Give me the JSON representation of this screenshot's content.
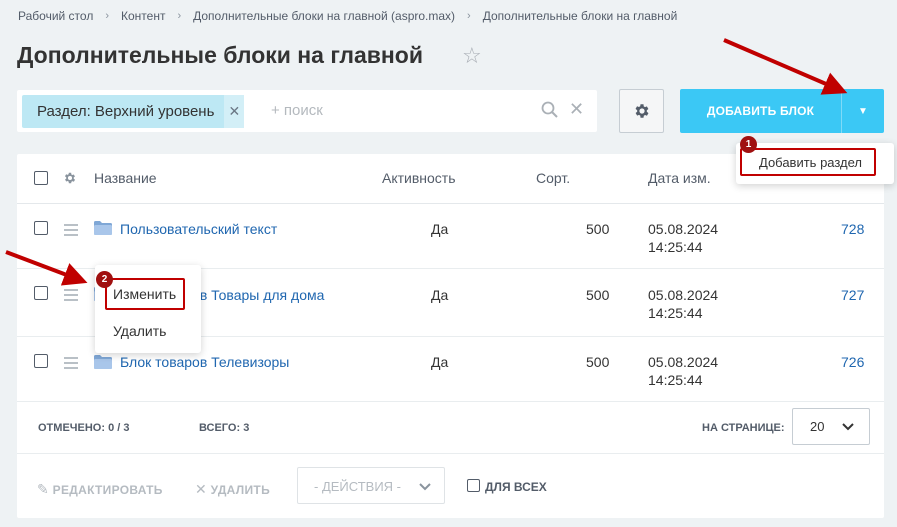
{
  "breadcrumb": [
    "Рабочий стол",
    "Контент",
    "Дополнительные блоки на главной (aspro.max)",
    "Дополнительные блоки на главной"
  ],
  "page_title": "Дополнительные блоки на главной",
  "filter": {
    "tag": "Раздел: Верхний уровень",
    "search_placeholder": "+ поиск"
  },
  "toolbar": {
    "add_label": "ДОБАВИТЬ БЛОК"
  },
  "add_menu": {
    "item": "Добавить раздел",
    "badge": "1"
  },
  "table": {
    "columns": [
      "Название",
      "Активность",
      "Сорт.",
      "Дата изм."
    ],
    "rows": [
      {
        "name": "Пользовательский текст",
        "active": "Да",
        "sort": "500",
        "date": "05.08.2024",
        "time": "14:25:44",
        "id": "728"
      },
      {
        "name": "Блок товаров Товары для дома",
        "active": "Да",
        "sort": "500",
        "date": "05.08.2024",
        "time": "14:25:44",
        "id": "727"
      },
      {
        "name": "Блок товаров Телевизоры",
        "active": "Да",
        "sort": "500",
        "date": "05.08.2024",
        "time": "14:25:44",
        "id": "726"
      }
    ]
  },
  "context_menu": {
    "edit": "Изменить",
    "delete": "Удалить",
    "badge": "2"
  },
  "footer": {
    "checked_label": "ОТМЕЧЕНО:",
    "checked_value": "0 / 3",
    "total_label": "ВСЕГО:",
    "total_value": "3",
    "per_page_label": "НА СТРАНИЦЕ:",
    "per_page_value": "20"
  },
  "actions": {
    "edit": "РЕДАКТИРОВАТЬ",
    "delete": "УДАЛИТЬ",
    "select_placeholder": "- ДЕЙСТВИЯ -",
    "for_all": "ДЛЯ ВСЕХ"
  },
  "colors": {
    "accent": "#3bc8f5",
    "link": "#2067b0",
    "highlight": "#c00000"
  }
}
